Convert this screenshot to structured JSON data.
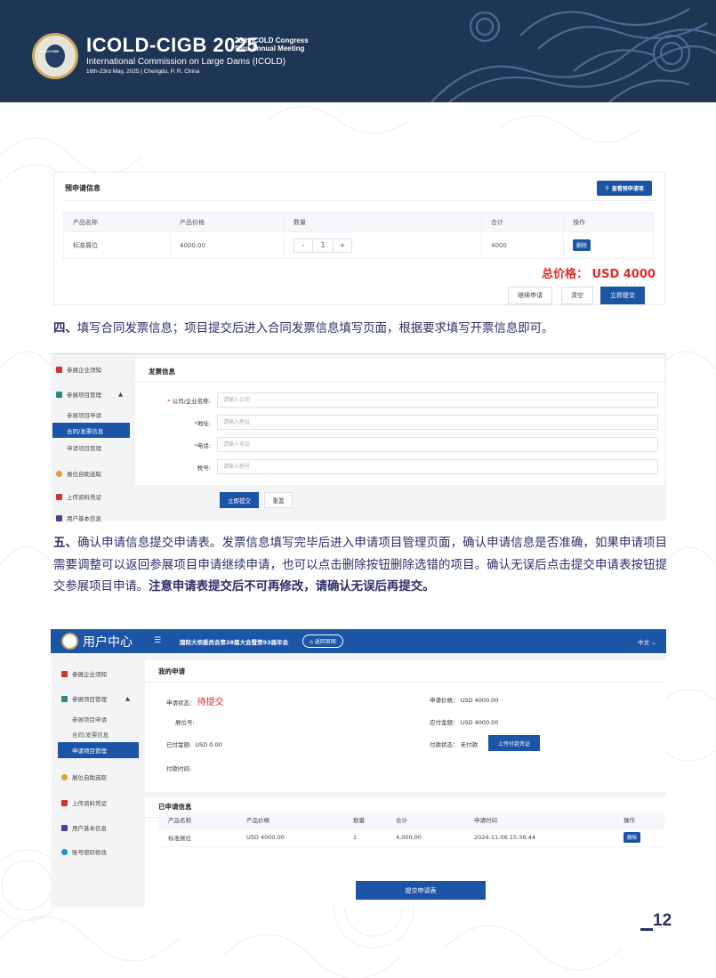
{
  "banner": {
    "title": "ICOLD-CIGB 2025",
    "congress_line1": "28th ICOLD Congress",
    "congress_line2": "93rd Annual Meeting",
    "subtitle": "International Commission on Large Dams (ICOLD)",
    "date": "16th-23rd May, 2025 | Chengdu, P. R. China",
    "colors": {
      "background": "#1f3556",
      "accent": "#c9a85a"
    }
  },
  "panel1": {
    "title": "预申请信息",
    "view_button": "查看预申请项",
    "columns": [
      "产品名称",
      "产品价格",
      "数量",
      "合计",
      "操作"
    ],
    "row": {
      "name": "标准展位",
      "price": "4000.00",
      "qty_minus": "-",
      "qty": "1",
      "qty_plus": "+",
      "total": "4000",
      "action": "删除"
    },
    "total_label": "总价格： USD 4000",
    "buttons": {
      "continue": "继续申请",
      "clear": "清空",
      "submit": "立即提交"
    }
  },
  "para4": {
    "lead": "四、",
    "text": "填写合同发票信息；项目提交后进入合同发票信息填写页面，根据要求填写开票信息即可。"
  },
  "panel2": {
    "sidebar": {
      "notice": "参展企业须知",
      "manage": "参展项目管理",
      "sub_apply": "参展项目申请",
      "sub_invoice": "合同/发票信息",
      "sub_manage": "申请项目管理",
      "booth": "展位自助选取",
      "upload": "上传资料凭证",
      "user_partial": "用户基本信息"
    },
    "heading": "发票信息",
    "fields": [
      {
        "label": "公司/企业名称:",
        "required": "*",
        "placeholder": "请输入公司"
      },
      {
        "label": "地址:",
        "required": "*",
        "placeholder": "请输入地址"
      },
      {
        "label": "电话:",
        "required": "*",
        "placeholder": "请输入电话"
      },
      {
        "label": "税号:",
        "required": "",
        "placeholder": "请输入税号"
      }
    ],
    "submit": "立即提交",
    "reset": "重置"
  },
  "para5": {
    "lead": "五、",
    "text": "确认申请信息提交申请表。发票信息填写完毕后进入申请项目管理页面，确认申请信息是否准确，如果申请项目需要调整可以返回参展项目申请继续申请，也可以点击删除按钮删除选错的项目。确认无误后点击提交申请表按钮提交参展项目申请。",
    "bold": "注意申请表提交后不可再修改，请确认无误后再提交。"
  },
  "panel3": {
    "topbar": {
      "user_center": "用户中心",
      "menu_icon": "☰",
      "conference": "国际大坝委员会第28届大会暨第93届年会",
      "home": "返回官网",
      "lang": "中文"
    },
    "sidebar": {
      "notice": "参展企业须知",
      "manage": "参展项目管理",
      "sub_apply": "参展项目申请",
      "sub_invoice": "合同/发票信息",
      "sub_manage": "申请项目管理",
      "booth": "展位自助选取",
      "upload": "上传资料凭证",
      "user_info": "用户基本信息",
      "password": "账号密码修改"
    },
    "my_apply": "我的申请",
    "status_label": "申请状态：",
    "status_value": "待提交",
    "price_label": "申请价格：",
    "price_value": "USD 4000.00",
    "booth_label": "展位号:",
    "due_label": "应付金额：",
    "due_value": "USD 4000.00",
    "paid_label": "已付金额:",
    "paid_value": "USD 0.00",
    "pay_status_label": "付款状态：",
    "pay_status_value": "未付款",
    "upload_btn": "上传付款凭证",
    "pay_time_label": "付款时间:",
    "applied_title": "已申请信息",
    "columns": [
      "产品名称",
      "产品价格",
      "数量",
      "合计",
      "申请时间",
      "操作"
    ],
    "row": {
      "name": "标准展位",
      "price": "USD 4000.00",
      "qty": "1",
      "total": "4,000.00",
      "time": "2024-11-06 15:36:44",
      "action": "删除"
    },
    "submit_form": "提交申请表"
  },
  "page_number": "12"
}
